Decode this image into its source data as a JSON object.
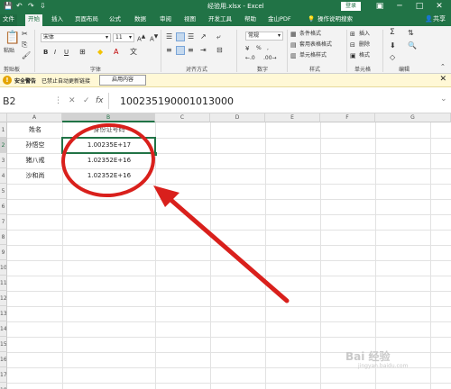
{
  "titlebar": {
    "title": "经验用.xlsx  -  Excel",
    "login": "登录",
    "qa_save": "💾",
    "qa_undo": "↶",
    "qa_redo": "↷",
    "qa_more": "⇩",
    "min": "─",
    "restore": "□",
    "close": "✕",
    "ribbon_display": "▣"
  },
  "tabs": {
    "items": [
      "文件",
      "开始",
      "插入",
      "页面布局",
      "公式",
      "数据",
      "审阅",
      "视图",
      "开发工具",
      "帮助",
      "金山PDF",
      "操作说明搜索"
    ],
    "share": "共享"
  },
  "ribbon": {
    "paste": "粘贴",
    "clipboard": "剪贴板",
    "font_name": "宋体",
    "font_size": "11",
    "bold": "B",
    "italic": "I",
    "underline": "U",
    "font_group": "字体",
    "align_group": "对齐方式",
    "number_format": "常规",
    "percent": "%",
    "comma": ",",
    "number_group": "数字",
    "cond_format": "条件格式",
    "table_format": "套用表格格式",
    "cell_style": "单元格样式",
    "style_group": "样式",
    "insert": "插入",
    "delete": "删除",
    "format": "格式",
    "cells_group": "单元格",
    "sum": "Σ",
    "edit_group": "编辑"
  },
  "security": {
    "title": "安全警告",
    "message": "已禁止自动更新链接",
    "enable": "启用内容",
    "close": "✕"
  },
  "formula_bar": {
    "name_box": "B2",
    "cancel": "✕",
    "enter": "✓",
    "fx": "fx",
    "content": "100235190001013000"
  },
  "grid": {
    "columns": [
      "A",
      "B",
      "C",
      "D",
      "E",
      "F",
      "G"
    ],
    "rows": [
      "1",
      "2",
      "3",
      "4",
      "5",
      "6",
      "7",
      "8",
      "9",
      "10",
      "11",
      "12",
      "13",
      "14",
      "15",
      "16",
      "17",
      "18"
    ],
    "cells": [
      {
        "a": "姓名",
        "b": "身份证号码"
      },
      {
        "a": "孙悟空",
        "b": "1.00235E+17"
      },
      {
        "a": "猪八戒",
        "b": "1.02352E+16"
      },
      {
        "a": "沙和尚",
        "b": "1.02352E+16"
      }
    ]
  },
  "annotation": {
    "circle_color": "#d9201c",
    "arrow_color": "#d9201c"
  },
  "watermark": {
    "brand": "Bai 经验",
    "url": "jingyan.baidu.com"
  },
  "colors": {
    "excel_green": "#217346"
  }
}
